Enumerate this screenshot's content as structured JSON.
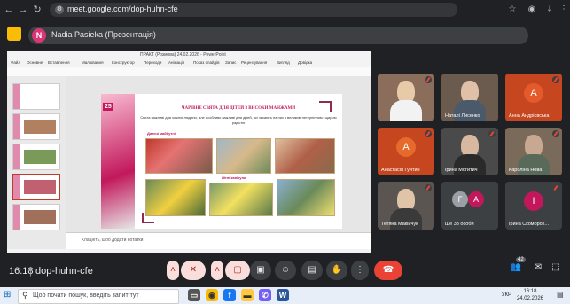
{
  "browser": {
    "url": "meet.google.com/dop-huhn-cfe"
  },
  "meet": {
    "presenter_label": "Nadia Pasieka (Презентація)",
    "presenter_initial": "N",
    "time": "16:18",
    "meeting_code": "dop-huhn-cfe",
    "participants_count": "42"
  },
  "ppt": {
    "title": "ПРАКТ (Розмова) 24.02.2026 - PowerPoint",
    "ribbon_tabs": [
      "Файл",
      "Основне",
      "Вставлення",
      "Малювання",
      "Конструктор",
      "Переходи",
      "Анімація",
      "Показ слайдів",
      "Запис",
      "Рецензування",
      "Вигляд",
      "Довідка"
    ],
    "notes_placeholder": "Клацніть, щоб додати нотатки",
    "slide": {
      "logo": "25",
      "title": "ЧАРІВНЕ СВЯТА ДЛЯ ДІТЕЙ З ВИСОКИ МАНЖАМИ",
      "subtitle": "Свята важливі для кожної людини, але особливо важливі для дітей, які чекають на них з великим нетерпінням і щирою радістю",
      "caption1": "Дитячі майбутні",
      "caption2": "Літні канікули"
    }
  },
  "participants": [
    {
      "name": "",
      "initial": "",
      "type": "video",
      "color": "#8a6d5a"
    },
    {
      "name": "Наталі Лисенко",
      "initial": "",
      "type": "video",
      "color": "#6b5b4f"
    },
    {
      "name": "Анна Андрієвська",
      "initial": "А",
      "type": "avatar",
      "color": "#c5461f"
    },
    {
      "name": "Анастасія Гуйтин",
      "initial": "А",
      "type": "avatar",
      "color": "#e66a2c"
    },
    {
      "name": "Ірина Могитич",
      "initial": "",
      "type": "video",
      "color": "#4a4a4a"
    },
    {
      "name": "Кароліна Нова",
      "initial": "",
      "type": "video",
      "color": "#7a6a5a"
    },
    {
      "name": "Тетяна Макійчук",
      "initial": "",
      "type": "video",
      "color": "#5a5550"
    },
    {
      "name": "Ще 33 особи",
      "initial": "Г",
      "type": "group",
      "color": "#5f6368"
    },
    {
      "name": "Ірина Скоморох...",
      "initial": "І",
      "type": "avatar",
      "color": "#c2185b"
    }
  ],
  "taskbar": {
    "search_placeholder": "Щоб почати пошук, введіть запит тут",
    "lang": "УКР",
    "clock_time": "16:18",
    "clock_date": "24.02.2026"
  }
}
